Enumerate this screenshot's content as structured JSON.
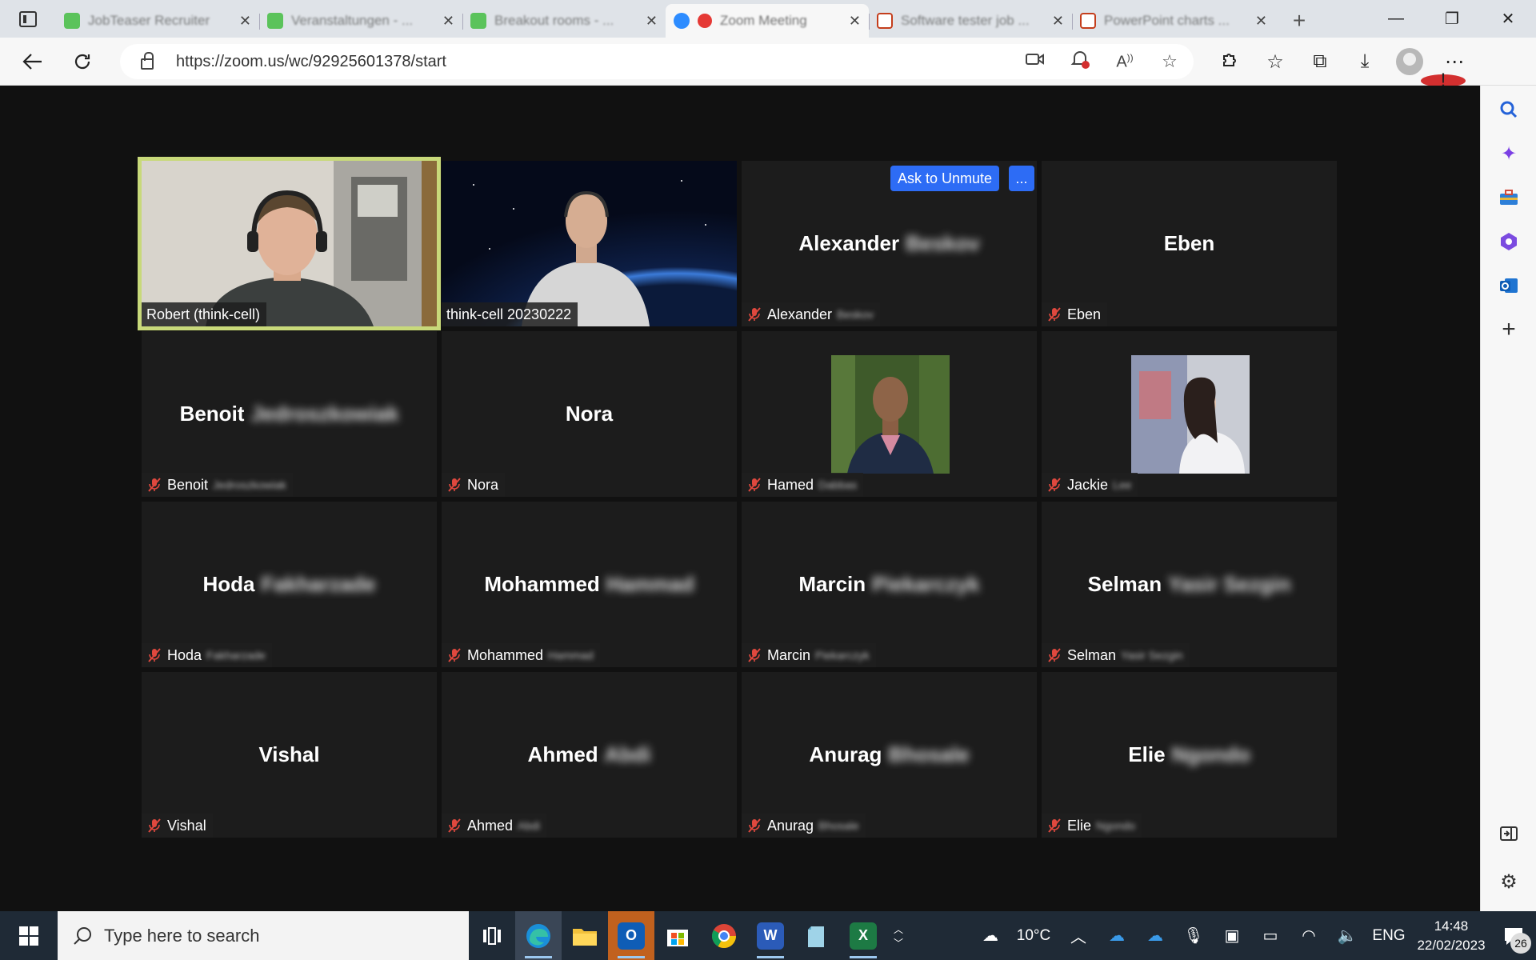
{
  "browser": {
    "tabs": [
      {
        "title": "JobTeaser Recruiter",
        "icon": "green-app-icon",
        "active": false
      },
      {
        "title": "Veranstaltungen - ...",
        "icon": "green-app-icon",
        "active": false
      },
      {
        "title": "Breakout rooms - ...",
        "icon": "green-app-icon",
        "active": false
      },
      {
        "title": "Zoom Meeting",
        "icon": "zoom-icon",
        "active": true
      },
      {
        "title": "Software tester job ...",
        "icon": "powerpoint-icon",
        "active": false
      },
      {
        "title": "PowerPoint charts ...",
        "icon": "powerpoint-icon",
        "active": false
      }
    ],
    "url": "https://zoom.us/wc/92925601378/start",
    "more_badge": "!"
  },
  "meeting": {
    "ask_to_unmute_label": "Ask to Unmute",
    "more_label": "...",
    "participants": [
      {
        "display_first": "Robert (think-cell)",
        "tag_first": "Robert (think-cell)",
        "tag_last": "",
        "video": "webcam-office",
        "muted": false,
        "active_speaker": true
      },
      {
        "display_first": "think-cell 20230222",
        "tag_first": "think-cell 20230222",
        "tag_last": "",
        "video": "webcam-space",
        "muted": false
      },
      {
        "display_first": "Alexander",
        "display_last": "Beskov",
        "tag_first": "Alexander",
        "tag_last": "Beskov",
        "muted": true
      },
      {
        "display_first": "Eben",
        "display_last": "",
        "tag_first": "Eben",
        "tag_last": "",
        "muted": true
      },
      {
        "display_first": "Benoit",
        "display_last": "Jedroszkowiak",
        "tag_first": "Benoit",
        "tag_last": "Jedroszkowiak",
        "muted": true
      },
      {
        "display_first": "Nora",
        "display_last": "",
        "tag_first": "Nora",
        "tag_last": "",
        "muted": true
      },
      {
        "display_first": "Hamed",
        "tag_first": "Hamed",
        "tag_last": "Dabbas",
        "photo": "profile-photo-man",
        "muted": true
      },
      {
        "display_first": "Jackie",
        "tag_first": "Jackie",
        "tag_last": "Lee",
        "photo": "profile-photo-woman",
        "muted": true
      },
      {
        "display_first": "Hoda",
        "display_last": "Fakharzade",
        "tag_first": "Hoda",
        "tag_last": "Fakharzade",
        "muted": true
      },
      {
        "display_first": "Mohammed",
        "display_last": "Hammad",
        "tag_first": "Mohammed",
        "tag_last": "Hammad",
        "muted": true
      },
      {
        "display_first": "Marcin",
        "display_last": "Piekarczyk",
        "tag_first": "Marcin",
        "tag_last": "Piekarczyk",
        "muted": true
      },
      {
        "display_first": "Selman",
        "display_last": "Yasir Sezgin",
        "tag_first": "Selman",
        "tag_last": "Yasir Sezgin",
        "muted": true
      },
      {
        "display_first": "Vishal",
        "display_last": "",
        "tag_first": "Vishal",
        "tag_last": "",
        "muted": true
      },
      {
        "display_first": "Ahmed",
        "display_last": "Abdi",
        "tag_first": "Ahmed",
        "tag_last": "Abdi",
        "muted": true
      },
      {
        "display_first": "Anurag",
        "display_last": "Bhosale",
        "tag_first": "Anurag",
        "tag_last": "Bhosale",
        "muted": true
      },
      {
        "display_first": "Elie",
        "display_last": "Ngondo",
        "tag_first": "Elie",
        "tag_last": "Ngondo",
        "muted": true
      }
    ]
  },
  "taskbar": {
    "search_placeholder": "Type here to search",
    "weather": "10°C",
    "language": "ENG",
    "time": "14:48",
    "date": "22/02/2023",
    "notification_count": "26",
    "apps": [
      "task-view",
      "edge",
      "file-explorer",
      "outlook",
      "store",
      "chrome",
      "word",
      "notepad",
      "excel"
    ]
  },
  "colors": {
    "active_speaker_border": "#c8d97a",
    "unmute_button": "#2d6cf5",
    "tile_bg": "#1c1c1c",
    "mic_off": "#e0483e"
  }
}
